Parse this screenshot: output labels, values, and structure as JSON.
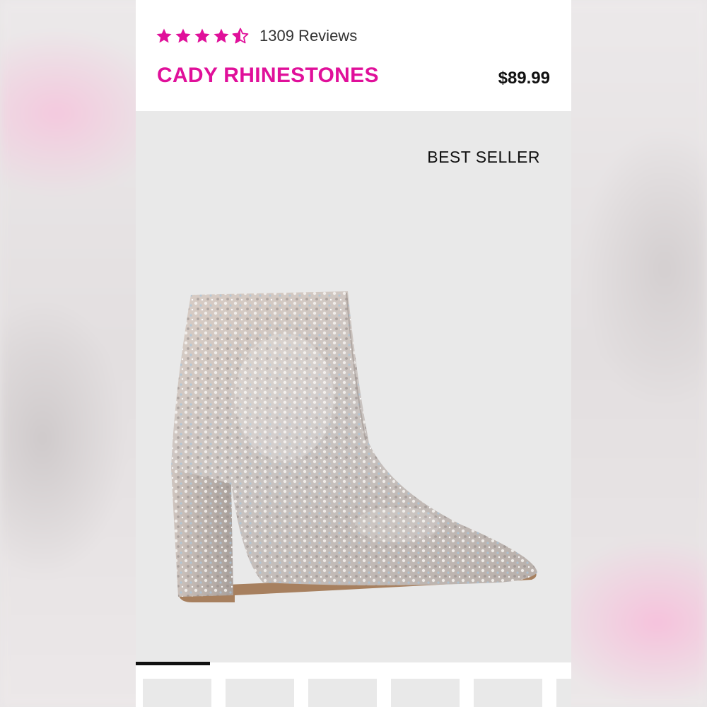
{
  "product": {
    "rating": 4.5,
    "rating_max": 5,
    "reviews_text": "1309 Reviews",
    "name": "CADY RHINESTONES",
    "price": "$89.99",
    "badge": "BEST SELLER"
  },
  "gallery": {
    "image": "rhinestone-ankle-boot",
    "current_slide": 1,
    "thumbnails": [
      "thumb-1",
      "thumb-2",
      "thumb-3",
      "thumb-4",
      "thumb-5",
      "thumb-6"
    ]
  },
  "colors": {
    "brand_pink": "#e0109a",
    "star_pink": "#e0109a",
    "hero_bg": "#e9e9e9"
  }
}
